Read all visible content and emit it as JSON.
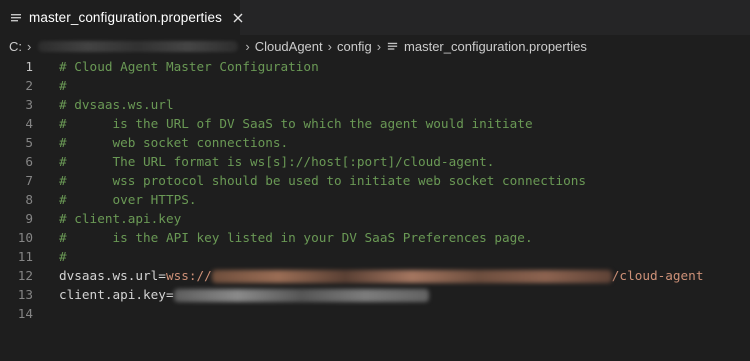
{
  "tab": {
    "icon": "lines-file-icon",
    "label": "master_configuration.properties",
    "close_icon": "close-icon"
  },
  "breadcrumb": {
    "root": "C:",
    "hidden_segment": "",
    "items": [
      "CloudAgent",
      "config"
    ],
    "file_label": "master_configuration.properties"
  },
  "editor": {
    "lines": [
      {
        "number": "1",
        "text": "# Cloud Agent Master Configuration"
      },
      {
        "number": "2",
        "text": "#"
      },
      {
        "number": "3",
        "text": "# dvsaas.ws.url"
      },
      {
        "number": "4",
        "text": "#      is the URL of DV SaaS to which the agent would initiate"
      },
      {
        "number": "5",
        "text": "#      web socket connections."
      },
      {
        "number": "6",
        "text": "#      The URL format is ws[s]://host[:port]/cloud-agent."
      },
      {
        "number": "7",
        "text": "#      wss protocol should be used to initiate web socket connections"
      },
      {
        "number": "8",
        "text": "#      over HTTPS."
      },
      {
        "number": "9",
        "text": "# client.api.key"
      },
      {
        "number": "10",
        "text": "#      is the API key listed in your DV SaaS Preferences page."
      },
      {
        "number": "11",
        "text": "#"
      },
      {
        "number": "12",
        "key": "dvsaas.ws.url=",
        "value_prefix": "wss://",
        "value_suffix": "/cloud-agent"
      },
      {
        "number": "13",
        "key": "client.api.key="
      },
      {
        "number": "14",
        "text": ""
      }
    ]
  },
  "colors": {
    "background": "#1e1e1e",
    "tabbar": "#252526",
    "comment": "#6a9955",
    "string": "#ce9178",
    "text": "#d4d4d4",
    "line_number": "#858585"
  }
}
